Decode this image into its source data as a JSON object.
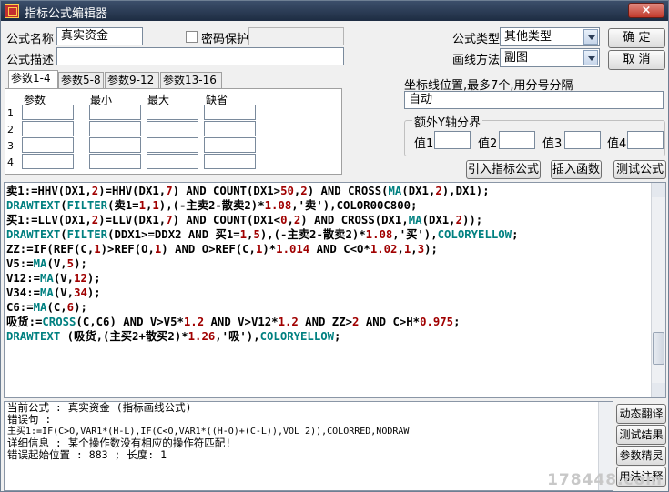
{
  "window": {
    "title": "指标公式编辑器",
    "close_label": "×"
  },
  "form": {
    "name_label": "公式名称",
    "name_value": "真实资金",
    "password_label": "密码保护",
    "desc_label": "公式描述",
    "desc_value": "",
    "type_label": "公式类型",
    "type_value": "其他类型",
    "draw_label": "画线方法",
    "draw_value": "副图",
    "ok_label": "确  定",
    "cancel_label": "取  消"
  },
  "tabs": [
    "参数1-4",
    "参数5-8",
    "参数9-12",
    "参数13-16"
  ],
  "params": {
    "headers": [
      "参数",
      "最小",
      "最大",
      "缺省"
    ],
    "rows": [
      "1",
      "2",
      "3",
      "4"
    ]
  },
  "coords": {
    "label": "坐标线位置,最多7个,用分号分隔",
    "value": "自动"
  },
  "yaxis": {
    "group_label": "额外Y轴分界",
    "labels": [
      "值1",
      "值2",
      "值3",
      "值4"
    ]
  },
  "actions": {
    "import_label": "引入指标公式",
    "insert_label": "插入函数",
    "test_label": "测试公式"
  },
  "code_lines": [
    [
      [
        "k",
        "卖1:=HHV(DX1,"
      ],
      [
        "n",
        "2"
      ],
      [
        "k",
        ")=HHV(DX1,"
      ],
      [
        "n",
        "7"
      ],
      [
        "k",
        ") AND COUNT(DX1>"
      ],
      [
        "n",
        "50"
      ],
      [
        "k",
        ","
      ],
      [
        "n",
        "2"
      ],
      [
        "k",
        ") AND CROSS("
      ],
      [
        "g",
        "MA"
      ],
      [
        "k",
        "(DX1,"
      ],
      [
        "n",
        "2"
      ],
      [
        "k",
        "),DX1);"
      ]
    ],
    [
      [
        "g",
        "DRAWTEXT"
      ],
      [
        "k",
        "("
      ],
      [
        "g",
        "FILTER"
      ],
      [
        "k",
        "(卖1="
      ],
      [
        "n",
        "1"
      ],
      [
        "k",
        ","
      ],
      [
        "n",
        "1"
      ],
      [
        "k",
        "),(-主卖2-散卖2)*"
      ],
      [
        "n",
        "1.08"
      ],
      [
        "k",
        ",'卖'),COLOR00C800;"
      ]
    ],
    [
      [
        "k",
        "买1:=LLV(DX1,"
      ],
      [
        "n",
        "2"
      ],
      [
        "k",
        ")=LLV(DX1,"
      ],
      [
        "n",
        "7"
      ],
      [
        "k",
        ") AND COUNT(DX1<"
      ],
      [
        "n",
        "0"
      ],
      [
        "k",
        ","
      ],
      [
        "n",
        "2"
      ],
      [
        "k",
        ") AND CROSS(DX1,"
      ],
      [
        "g",
        "MA"
      ],
      [
        "k",
        "(DX1,"
      ],
      [
        "n",
        "2"
      ],
      [
        "k",
        "));"
      ]
    ],
    [
      [
        "g",
        "DRAWTEXT"
      ],
      [
        "k",
        "("
      ],
      [
        "g",
        "FILTER"
      ],
      [
        "k",
        "(DDX1>=DDX2 AND 买1="
      ],
      [
        "n",
        "1"
      ],
      [
        "k",
        ","
      ],
      [
        "n",
        "5"
      ],
      [
        "k",
        "),(-主卖2-散卖2)*"
      ],
      [
        "n",
        "1.08"
      ],
      [
        "k",
        ",'买'),"
      ],
      [
        "g",
        "COLORYELLOW"
      ],
      [
        "k",
        ";"
      ]
    ],
    [
      [
        "k",
        "ZZ:=IF(REF(C,"
      ],
      [
        "n",
        "1"
      ],
      [
        "k",
        ")>REF(O,"
      ],
      [
        "n",
        "1"
      ],
      [
        "k",
        ") AND O>REF(C,"
      ],
      [
        "n",
        "1"
      ],
      [
        "k",
        ")*"
      ],
      [
        "n",
        "1.014"
      ],
      [
        "k",
        " AND C<O*"
      ],
      [
        "n",
        "1.02"
      ],
      [
        "k",
        ","
      ],
      [
        "n",
        "1"
      ],
      [
        "k",
        ","
      ],
      [
        "n",
        "3"
      ],
      [
        "k",
        ");"
      ]
    ],
    [
      [
        "k",
        "V5:="
      ],
      [
        "g",
        "MA"
      ],
      [
        "k",
        "(V,"
      ],
      [
        "n",
        "5"
      ],
      [
        "k",
        ");"
      ]
    ],
    [
      [
        "k",
        "V12:="
      ],
      [
        "g",
        "MA"
      ],
      [
        "k",
        "(V,"
      ],
      [
        "n",
        "12"
      ],
      [
        "k",
        ");"
      ]
    ],
    [
      [
        "k",
        "V34:="
      ],
      [
        "g",
        "MA"
      ],
      [
        "k",
        "(V,"
      ],
      [
        "n",
        "34"
      ],
      [
        "k",
        ");"
      ]
    ],
    [
      [
        "k",
        "C6:="
      ],
      [
        "g",
        "MA"
      ],
      [
        "k",
        "(C,"
      ],
      [
        "n",
        "6"
      ],
      [
        "k",
        ");"
      ]
    ],
    [
      [
        "k",
        "吸货:="
      ],
      [
        "g",
        "CROSS"
      ],
      [
        "k",
        "(C,C6) AND V>V5*"
      ],
      [
        "n",
        "1.2"
      ],
      [
        "k",
        " AND V>V12*"
      ],
      [
        "n",
        "1.2"
      ],
      [
        "k",
        " AND ZZ>"
      ],
      [
        "n",
        "2"
      ],
      [
        "k",
        " AND C>H*"
      ],
      [
        "n",
        "0.975"
      ],
      [
        "k",
        ";"
      ]
    ],
    [
      [
        "g",
        "DRAWTEXT"
      ],
      [
        "k",
        " (吸货,(主买2+散买2)*"
      ],
      [
        "n",
        "1.26"
      ],
      [
        "k",
        ",'吸'),"
      ],
      [
        "g",
        "COLORYELLOW"
      ],
      [
        "k",
        ";"
      ]
    ]
  ],
  "messages": [
    "当前公式 : 真实资金 (指标画线公式)",
    "错误句 :",
    "主买1:=IF(C>O,VAR1*(H-L),IF(C<O,VAR1*((H-O)+(C-L)),VOL 2)),COLORRED,NODRAW",
    "详细信息 : 某个操作数没有相应的操作符匹配!",
    "错误起始位置 : 883 ; 长度: 1"
  ],
  "side_buttons": [
    "动态翻译",
    "测试结果",
    "参数精灵",
    "用法注释"
  ],
  "watermark": "178448.com"
}
